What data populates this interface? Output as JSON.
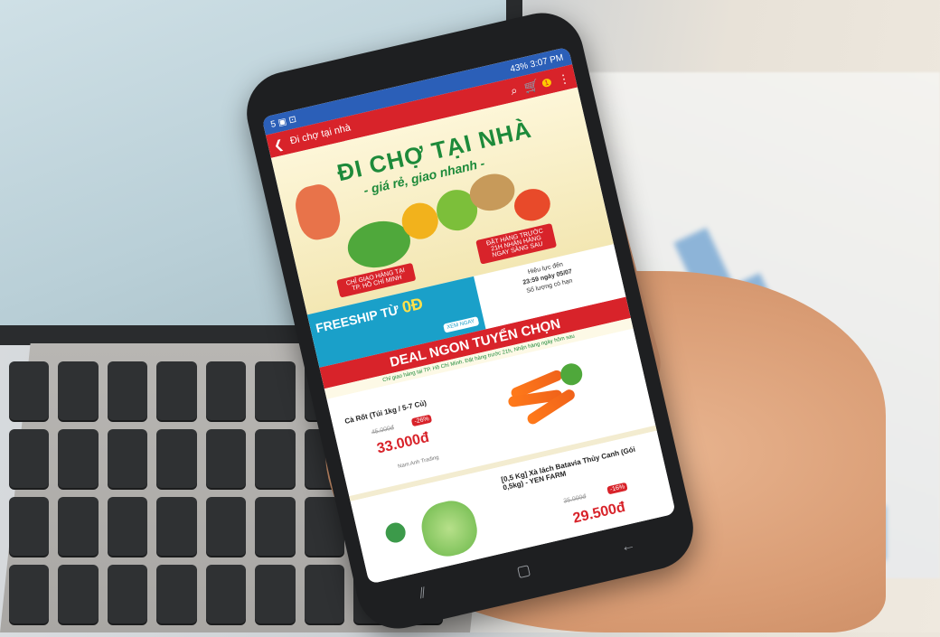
{
  "status": {
    "left": "5 ▣ ⊡",
    "right": "43% 3:07 PM"
  },
  "appbar": {
    "title": "Đi chợ tại nhà",
    "back": "❮",
    "search": "⌕",
    "cart": "🛒",
    "cart_count": "1",
    "menu": "⋮"
  },
  "banner": {
    "title": "ĐI CHỢ TẠI NHÀ",
    "subtitle": "- giá rẻ, giao nhanh -",
    "tag_left": "CHỈ GIAO HÀNG TẠI TP. HỒ CHÍ MINH",
    "tag_right": "ĐẶT HÀNG TRƯỚC 21H NHẬN HÀNG NGAY SÁNG SAU"
  },
  "promo": {
    "freeship_label": "FREESHIP TỪ",
    "freeship_value": "0Đ",
    "learn_more": "XEM NGAY",
    "time_label": "Hiệu lực đến",
    "time_value": "23:59 ngày 05/07",
    "qty_label": "Số lượng có hạn"
  },
  "deal": {
    "title": "DEAL NGON TUYỂN CHỌN",
    "subtitle": "Chỉ giao hàng tại TP. Hồ Chí Minh. Đặt hàng trước 21h, Nhận hàng ngày hôm sau"
  },
  "products": [
    {
      "name": "Cà Rốt (Túi 1kg / 5-7 Củ)",
      "old_price": "45.000đ",
      "discount": "-26%",
      "price": "33.000đ",
      "seller": "Nam Anh Trading"
    },
    {
      "name": "[0,5 Kg] Xà lách Batavia Thủy Canh (Gói 0,5kg) - YEN FARM",
      "old_price": "35.000đ",
      "discount": "-16%",
      "price": "29.500đ"
    }
  ],
  "nav": {
    "recent": "⫽",
    "home": "▢",
    "back": "←"
  },
  "colors": {
    "brand_red": "#d8232a",
    "status_blue": "#2b5fb8",
    "green": "#1d8a3a"
  }
}
